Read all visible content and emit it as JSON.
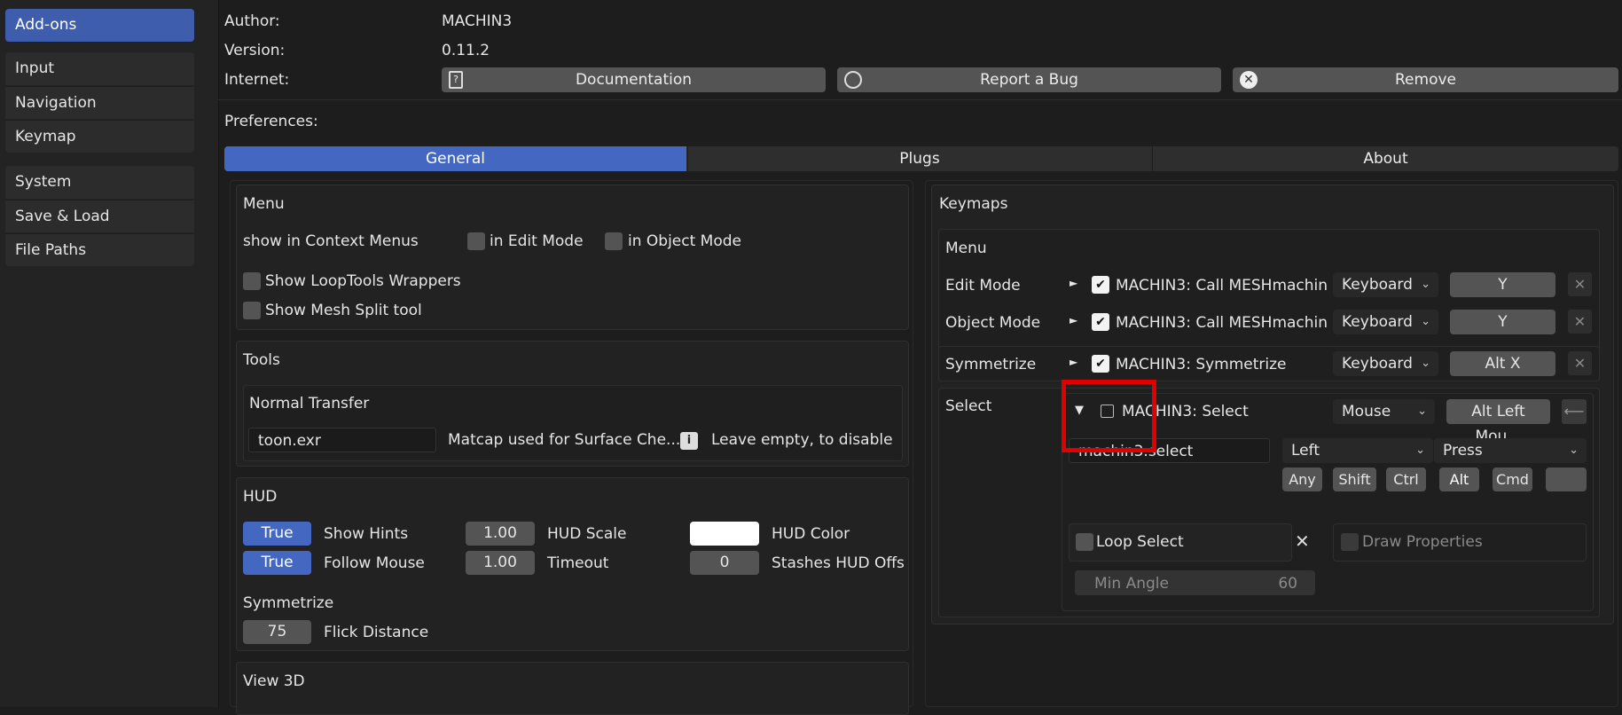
{
  "sidebar": {
    "items": [
      "Add-ons",
      "Input",
      "Navigation",
      "Keymap",
      "System",
      "Save & Load",
      "File Paths"
    ]
  },
  "addon_info": {
    "author_label": "Author:",
    "author_value": "MACHIN3",
    "version_label": "Version:",
    "version_value": "0.11.2",
    "internet_label": "Internet:",
    "documentation": "Documentation",
    "report_bug": "Report a Bug",
    "remove": "Remove"
  },
  "preferences_label": "Preferences:",
  "tabs": [
    "General",
    "Plugs",
    "About"
  ],
  "menu_panel": {
    "title": "Menu",
    "context_label": "show in Context Menus",
    "edit_mode": "in Edit Mode",
    "object_mode": "in Object Mode",
    "loop_tools": "Show LoopTools Wrappers",
    "mesh_split": "Show Mesh Split tool"
  },
  "tools_panel": {
    "title": "Tools",
    "normal_transfer": "Normal Transfer",
    "matcap_value": "toon.exr",
    "matcap_label": "Matcap used for Surface Che...",
    "hint": "Leave empty, to disable"
  },
  "hud_panel": {
    "title": "HUD",
    "show_hints_value": "True",
    "show_hints_label": "Show Hints",
    "follow_mouse_value": "True",
    "follow_mouse_label": "Follow Mouse",
    "hud_scale_value": "1.00",
    "hud_scale_label": "HUD Scale",
    "timeout_value": "1.00",
    "timeout_label": "Timeout",
    "hud_color_label": "HUD Color",
    "hud_color": "#ffffff",
    "stashes_value": "0",
    "stashes_label": "Stashes HUD Offs",
    "symmetrize_title": "Symmetrize",
    "flick_value": "75",
    "flick_label": "Flick Distance"
  },
  "view3d_title": "View 3D",
  "keymaps": {
    "title": "Keymaps",
    "menu_title": "Menu",
    "rows": [
      {
        "mode": "Edit Mode",
        "name": "MACHIN3: Call MESHmachin",
        "device": "Keyboard",
        "key": "Y"
      },
      {
        "mode": "Object Mode",
        "name": "MACHIN3: Call MESHmachin",
        "device": "Keyboard",
        "key": "Y"
      },
      {
        "mode": "Symmetrize",
        "name": "MACHIN3: Symmetrize",
        "device": "Keyboard",
        "key": "Alt X"
      }
    ],
    "select": {
      "mode": "Select",
      "name": "MACHIN3: Select",
      "device": "Mouse",
      "key": "Alt Left Mou...",
      "operator": "machin3.select",
      "button": "Left",
      "event": "Press",
      "mods": [
        "Any",
        "Shift",
        "Ctrl",
        "Alt",
        "Cmd"
      ],
      "loop_select": "Loop Select",
      "draw_properties": "Draw Properties",
      "min_angle_label": "Min Angle",
      "min_angle_value": "60"
    }
  }
}
